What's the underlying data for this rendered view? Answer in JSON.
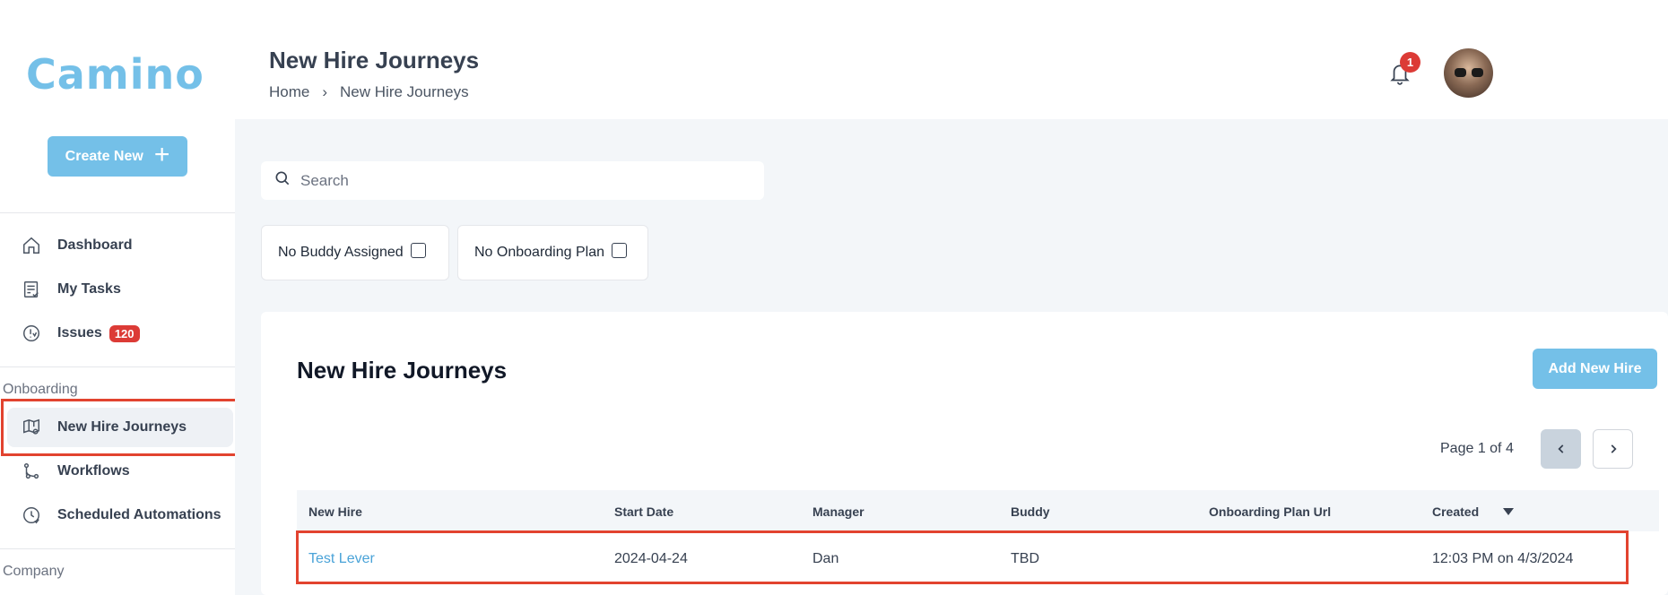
{
  "sidebar": {
    "logo": "Camino",
    "create_label": "Create New",
    "items": [
      {
        "label": "Dashboard"
      },
      {
        "label": "My Tasks"
      },
      {
        "label": "Issues",
        "badge": "120"
      },
      {
        "label": "New Hire Journeys"
      },
      {
        "label": "Workflows"
      },
      {
        "label": "Scheduled Automations"
      }
    ],
    "sections": {
      "onboarding": "Onboarding",
      "company": "Company"
    }
  },
  "header": {
    "title": "New Hire Journeys",
    "breadcrumb": {
      "home": "Home",
      "separator": "›",
      "current": "New Hire Journeys"
    },
    "notification_count": "1"
  },
  "search": {
    "placeholder": "Search"
  },
  "filters": [
    {
      "label": "No Buddy Assigned"
    },
    {
      "label": "No Onboarding Plan"
    }
  ],
  "card": {
    "title": "New Hire Journeys",
    "add_label": "Add New Hire",
    "pagination": "Page 1 of 4"
  },
  "table": {
    "columns": [
      "New Hire",
      "Start Date",
      "Manager",
      "Buddy",
      "Onboarding Plan Url",
      "Created"
    ],
    "rows": [
      {
        "new_hire": "Test Lever",
        "start_date": "2024-04-24",
        "manager": "Dan",
        "buddy": "TBD",
        "plan_url": "",
        "created": "12:03 PM on 4/3/2024"
      }
    ]
  },
  "colors": {
    "accent": "#74c0e8",
    "badge": "#dc3b36",
    "highlight": "#e2432f",
    "link": "#4aa3d8"
  }
}
